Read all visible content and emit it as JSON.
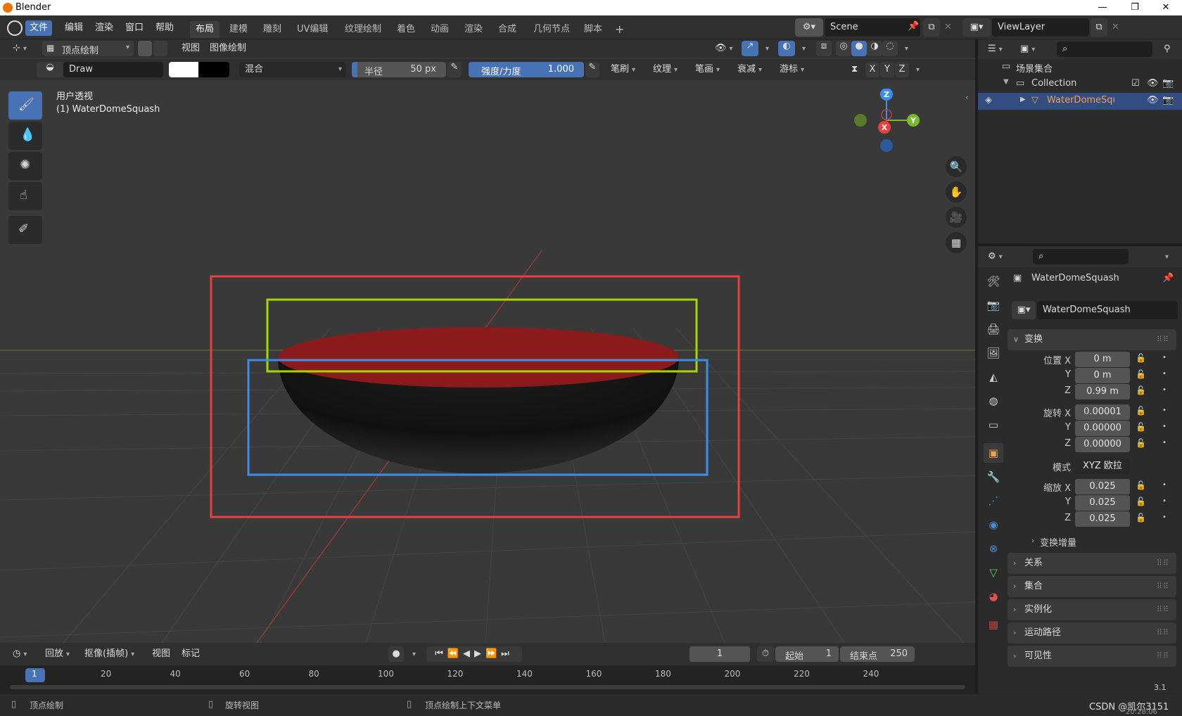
{
  "app": {
    "title": "Blender"
  },
  "window_buttons": {
    "min": "—",
    "max": "❐",
    "close": "✕"
  },
  "menu": [
    "文件",
    "编辑",
    "渲染",
    "窗口",
    "帮助"
  ],
  "workspaces": [
    "布局",
    "建模",
    "雕刻",
    "UV编辑",
    "纹理绘制",
    "着色",
    "动画",
    "渲染",
    "合成",
    "几何节点",
    "脚本",
    "+"
  ],
  "scene": {
    "name": "Scene"
  },
  "view_layer": {
    "name": "ViewLayer"
  },
  "viewport_header": {
    "mode": "顶点绘制",
    "menus": [
      "视图",
      "图像绘制"
    ]
  },
  "tool_settings": {
    "brush_name": "Draw",
    "blend": "混合",
    "radius_label": "半径",
    "radius_value": "50 px",
    "strength_label": "强度/力度",
    "strength_value": "1.000",
    "strength_fill": 1.0,
    "panels": [
      "笔刷",
      "纹理",
      "笔画",
      "衰减",
      "游标"
    ],
    "axes": [
      "X",
      "Y",
      "Z"
    ]
  },
  "viewport": {
    "view_name": "用户透视",
    "object_label": "(1) WaterDomeSquash",
    "gizmo": {
      "x": "X",
      "y": "Y",
      "z": "Z"
    },
    "colors": {
      "red_box": "#e8403c",
      "green_box": "#a8d400",
      "blue_box": "#3c8ee8",
      "dome_top": "#8b1a1c"
    }
  },
  "outliner": {
    "scene_collection": "场景集合",
    "collection": "Collection",
    "object": "WaterDomeSquash"
  },
  "properties": {
    "object_name": "WaterDomeSquash",
    "data_name": "WaterDomeSquash",
    "transform_title": "变换",
    "location": {
      "label": "位置 X",
      "x": "0 m",
      "y": "0 m",
      "z": "0.99 m"
    },
    "rotation": {
      "label": "旋转 X",
      "x": "0.00001",
      "y": "0.00000",
      "z": "0.00000"
    },
    "mode_label": "模式",
    "mode_value": "XYZ 欧拉",
    "scale": {
      "label": "缩放 X",
      "x": "0.025",
      "y": "0.025",
      "z": "0.025"
    },
    "axis_y": "Y",
    "axis_z": "Z",
    "delta": "变换增量",
    "sections": [
      "关系",
      "集合",
      "实例化",
      "运动路径",
      "可见性"
    ]
  },
  "timeline": {
    "menus": [
      "回放",
      "抠像(插帧)",
      "视图",
      "标记"
    ],
    "current_frame": "1",
    "start_label": "起始",
    "start_value": "1",
    "end_label": "结束点",
    "end_value": "250",
    "ruler": [
      "1",
      "20",
      "40",
      "60",
      "80",
      "100",
      "120",
      "140",
      "160",
      "180",
      "200",
      "220",
      "240"
    ]
  },
  "status": {
    "left": "顶点绘制",
    "mid": "旋转视图",
    "right": "顶点绘制上下文菜单",
    "watermark": "CSDN @凯尔3151",
    "version": "3.1",
    "time": "20:28:06"
  }
}
